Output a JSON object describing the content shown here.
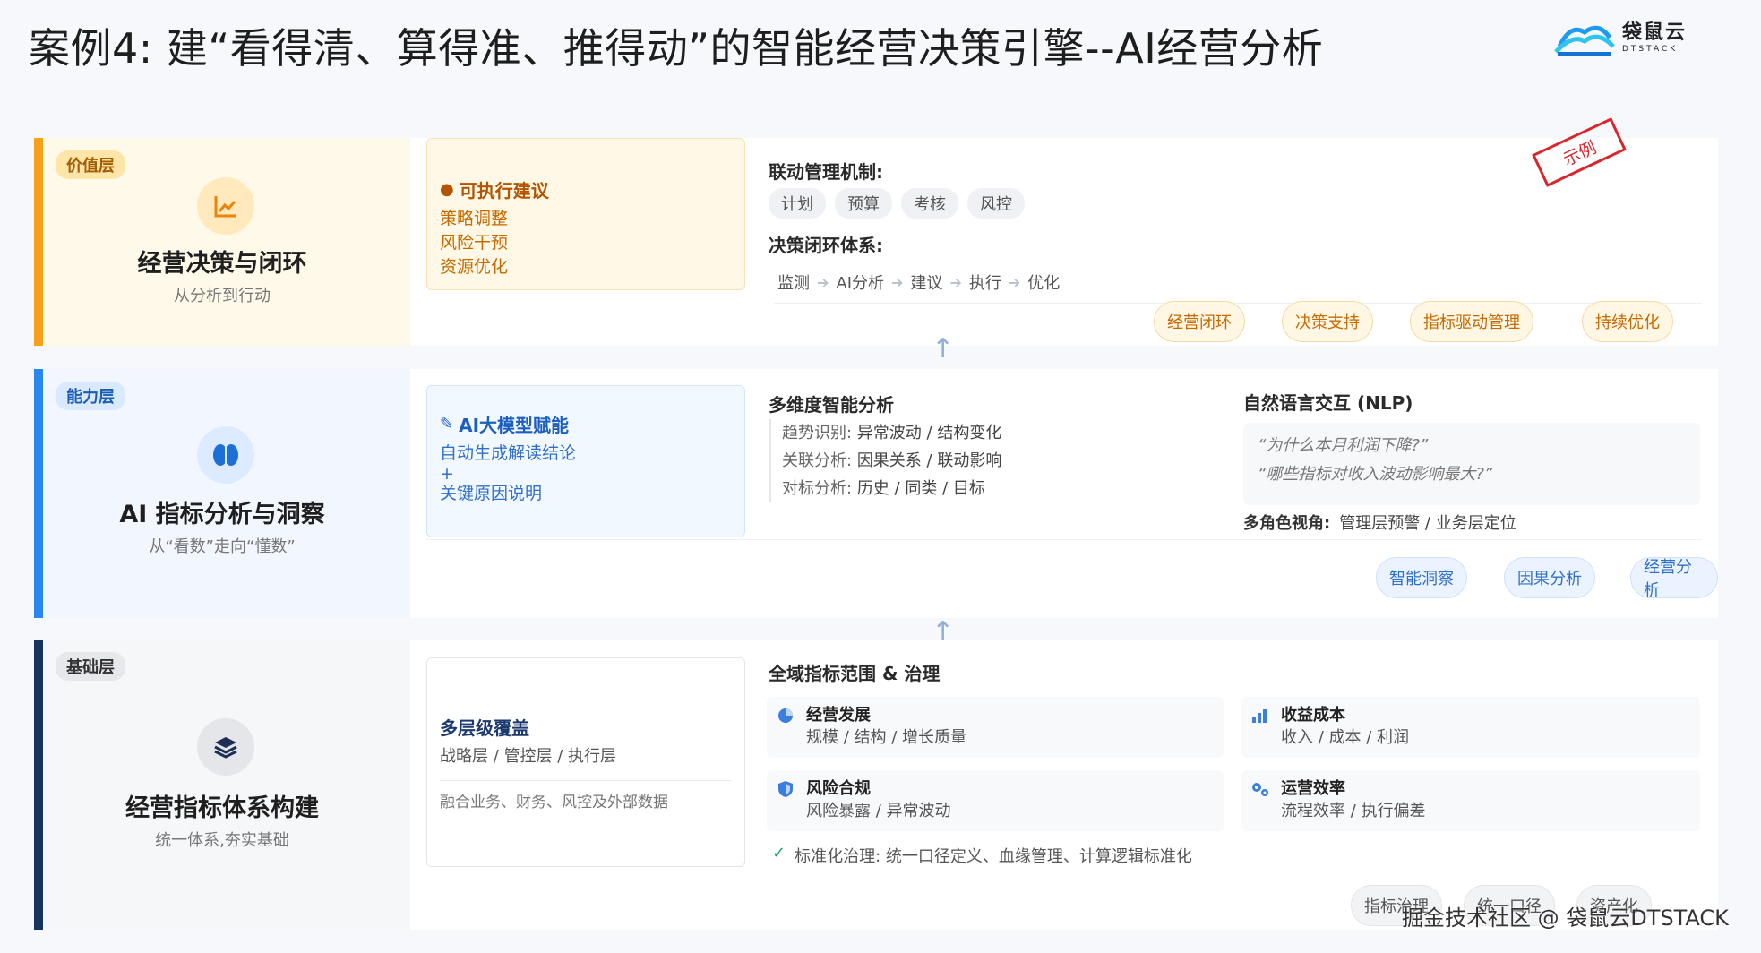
{
  "page": {
    "title": "案例4:  建“看得清、算得准、推得动”的智能经营决策引擎--AI经营分析",
    "logo_cn": "袋鼠云",
    "logo_en": "DTSTACK",
    "stamp": "示例",
    "watermark": "掘金技术社区 @ 袋鼠云DTSTACK"
  },
  "value_layer": {
    "badge": "价值层",
    "icon": "chart-line-icon",
    "title": "经营决策与闭环",
    "subtitle": "从分析到行动",
    "card": {
      "title": "可执行建议",
      "icon": "lightbulb-icon",
      "lines": [
        "策略调整",
        "风险干预",
        "资源优化"
      ]
    },
    "linkage_title": "联动管理机制:",
    "linkage_chips": [
      "计划",
      "预算",
      "考核",
      "风控"
    ],
    "loop_title": "决策闭环体系:",
    "loop_steps": [
      "监测",
      "AI分析",
      "建议",
      "执行",
      "优化"
    ],
    "tags": [
      "经营闭环",
      "决策支持",
      "指标驱动管理",
      "持续优化"
    ]
  },
  "ability_layer": {
    "badge": "能力层",
    "icon": "brain-icon",
    "title": "AI 指标分析与洞察",
    "subtitle": "从“看数”走向“懂数”",
    "card": {
      "title": "AI大模型赋能",
      "icon": "magic-wand-icon",
      "lines": [
        "自动生成解读结论",
        "+",
        "关键原因说明"
      ]
    },
    "multi_title": "多维度智能分析",
    "multi_rows": [
      {
        "k": "趋势识别:",
        "v": "异常波动 / 结构变化"
      },
      {
        "k": "关联分析:",
        "v": "因果关系 / 联动影响"
      },
      {
        "k": "对标分析:",
        "v": "历史 / 同类 / 目标"
      }
    ],
    "nlp_title": "自然语言交互 (NLP)",
    "nlp_quotes": [
      "“为什么本月利润下降?”",
      "“哪些指标对收入波动影响最大?”"
    ],
    "roles_label": "多角色视角:",
    "roles_value": "管理层预警 / 业务层定位",
    "tags": [
      "智能洞察",
      "因果分析",
      "经营分析"
    ]
  },
  "base_layer": {
    "badge": "基础层",
    "icon": "layers-icon",
    "title": "经营指标体系构建",
    "subtitle": "统一体系,夯实基础",
    "card": {
      "title": "多层级覆盖",
      "line": "战略层 / 管控层 / 执行层",
      "note": "融合业务、财务、风控及外部数据"
    },
    "scope_title": "全域指标范围 & 治理",
    "domains": [
      {
        "name": "经营发展",
        "desc": "规模 / 结构 / 增长质量",
        "icon": "pie-chart-icon"
      },
      {
        "name": "收益成本",
        "desc": "收入 / 成本 / 利润",
        "icon": "money-chart-icon"
      },
      {
        "name": "风险合规",
        "desc": "风险暴露 / 异常波动",
        "icon": "shield-icon"
      },
      {
        "name": "运营效率",
        "desc": "流程效率 / 执行偏差",
        "icon": "gears-icon"
      }
    ],
    "governance": "标准化治理: 统一口径定义、血缘管理、计算逻辑标准化",
    "tags": [
      "指标治理",
      "统一口径",
      "资产化"
    ]
  }
}
